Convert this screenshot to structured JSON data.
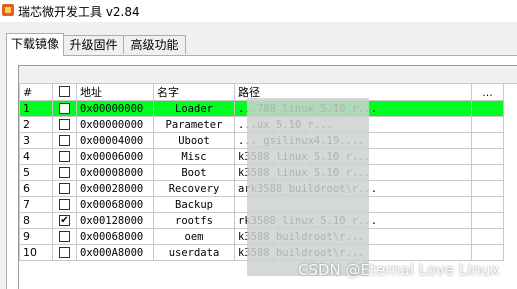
{
  "window": {
    "title": "瑞芯微开发工具 v2.84"
  },
  "tabs": [
    {
      "label": "下载镜像"
    },
    {
      "label": "升级固件"
    },
    {
      "label": "高级功能"
    }
  ],
  "table": {
    "headers": {
      "index": "#",
      "check": "",
      "address": "地址",
      "name": "名字",
      "path": "路径",
      "more": "..."
    },
    "rows": [
      {
        "index": "1",
        "checked": false,
        "address": "0x00000000",
        "name": "Loader",
        "path": "...788_linux_5.10_r..."
      },
      {
        "index": "2",
        "checked": false,
        "address": "0x00000000",
        "name": "Parameter",
        "path": "...ux_5.10_r..."
      },
      {
        "index": "3",
        "checked": false,
        "address": "0x00004000",
        "name": "Uboot",
        "path": "..._gsilinux4.19...."
      },
      {
        "index": "4",
        "checked": false,
        "address": "0x00006000",
        "name": "Misc",
        "path": "k3588_linux_5.10_r..."
      },
      {
        "index": "5",
        "checked": false,
        "address": "0x00008000",
        "name": "Boot",
        "path": "k3588_linux_5.10_r..."
      },
      {
        "index": "6",
        "checked": false,
        "address": "0x00028000",
        "name": "Recovery",
        "path": "ark3588_buildroot\\r..."
      },
      {
        "index": "7",
        "checked": false,
        "address": "0x00068000",
        "name": "Backup",
        "path": ""
      },
      {
        "index": "8",
        "checked": true,
        "address": "0x00128000",
        "name": "rootfs",
        "path": "rk3588_linux_5.10_r..."
      },
      {
        "index": "9",
        "checked": false,
        "address": "0x00068000",
        "name": "oem",
        "path": "k3588_buildroot\\r..."
      },
      {
        "index": "10",
        "checked": false,
        "address": "0x000A8000",
        "name": "userdata",
        "path": "k3588_buildroot\\r..."
      }
    ],
    "selected_row": 1,
    "selected_color": "#00ff20"
  },
  "watermark": "CSDN @Eternal Love Linux"
}
